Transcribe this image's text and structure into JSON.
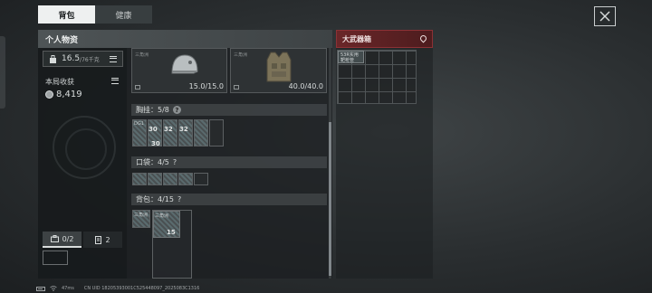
{
  "tabs": {
    "backpack": "背包",
    "health": "健康"
  },
  "personal": {
    "title": "个人物资",
    "weight_value": "16.5",
    "weight_capacity": "/76千克",
    "income_label": "本局收获",
    "income_value": "8,419",
    "bottom_tab_1": "0/2",
    "bottom_tab_2": "2"
  },
  "gear": {
    "helmet_label": "三角洲",
    "helmet_durability": "15.0/15.0",
    "armor_label": "三角洲",
    "armor_durability": "40.0/40.0"
  },
  "chest_rig": {
    "label": "胸挂：5/8",
    "help": "?",
    "ammo_tag": "DG1",
    "ammo_counts": [
      "30",
      "32",
      "30",
      "32"
    ]
  },
  "pockets": {
    "label": "口袋：4/5",
    "help": "?"
  },
  "backpack": {
    "label": "背包：4/15",
    "help": "?",
    "item_qty": "15",
    "item_label_1": "三角洲",
    "item_label_2": "三角洲"
  },
  "weapons_box": {
    "title": "大武器箱",
    "item_label": "53R实用靶枪管"
  },
  "status": {
    "ping": "47ms",
    "uid": "CN UID 18205393001C525448097_2025083C1316"
  },
  "colors": {
    "accent_red": "#6a2628",
    "panel_header": "#4e5456",
    "active_tab": "#eef0f0"
  }
}
